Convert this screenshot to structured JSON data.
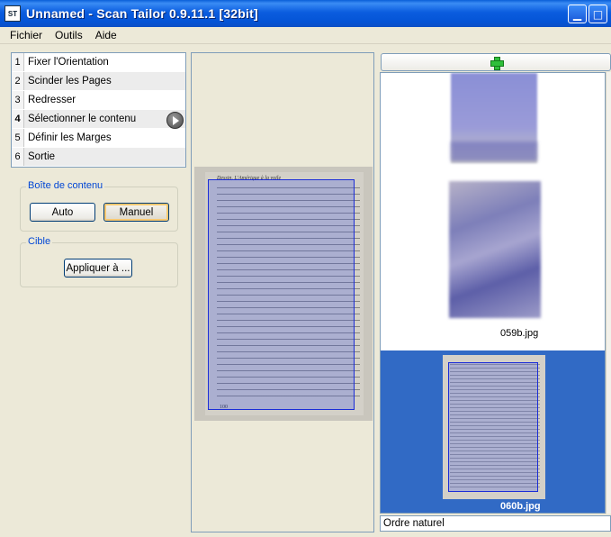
{
  "window": {
    "title": "Unnamed - Scan Tailor 0.9.11.1 [32bit]",
    "icon_text": "ST",
    "minimize_glyph": "▁",
    "maximize_glyph": "□"
  },
  "menu": [
    "Fichier",
    "Outils",
    "Aide"
  ],
  "stages": [
    {
      "num": "1",
      "label": "Fixer l'Orientation"
    },
    {
      "num": "2",
      "label": "Scinder les Pages"
    },
    {
      "num": "3",
      "label": "Redresser"
    },
    {
      "num": "4",
      "label": "Sélectionner le contenu",
      "selected": true
    },
    {
      "num": "5",
      "label": "Définir les Marges"
    },
    {
      "num": "6",
      "label": "Sortie"
    }
  ],
  "content_box": {
    "title": "Boîte de contenu",
    "auto_label": "Auto",
    "manual_label": "Manuel"
  },
  "target": {
    "title": "Cible",
    "apply_label": "Appliquer à ..."
  },
  "page_preview": {
    "header_text": "Dessin, L'Amérique à la voile",
    "page_number": "100"
  },
  "thumbnails": [
    {
      "label": ""
    },
    {
      "label": "059b.jpg"
    },
    {
      "label": "060b.jpg",
      "selected": true
    }
  ],
  "sort_order": {
    "selected": "Ordre naturel"
  },
  "colors": {
    "titlebar": "#0b5ddf",
    "selection": "#316ac5",
    "content_box_border": "#1b2dd8",
    "group_title": "#0046d5"
  }
}
